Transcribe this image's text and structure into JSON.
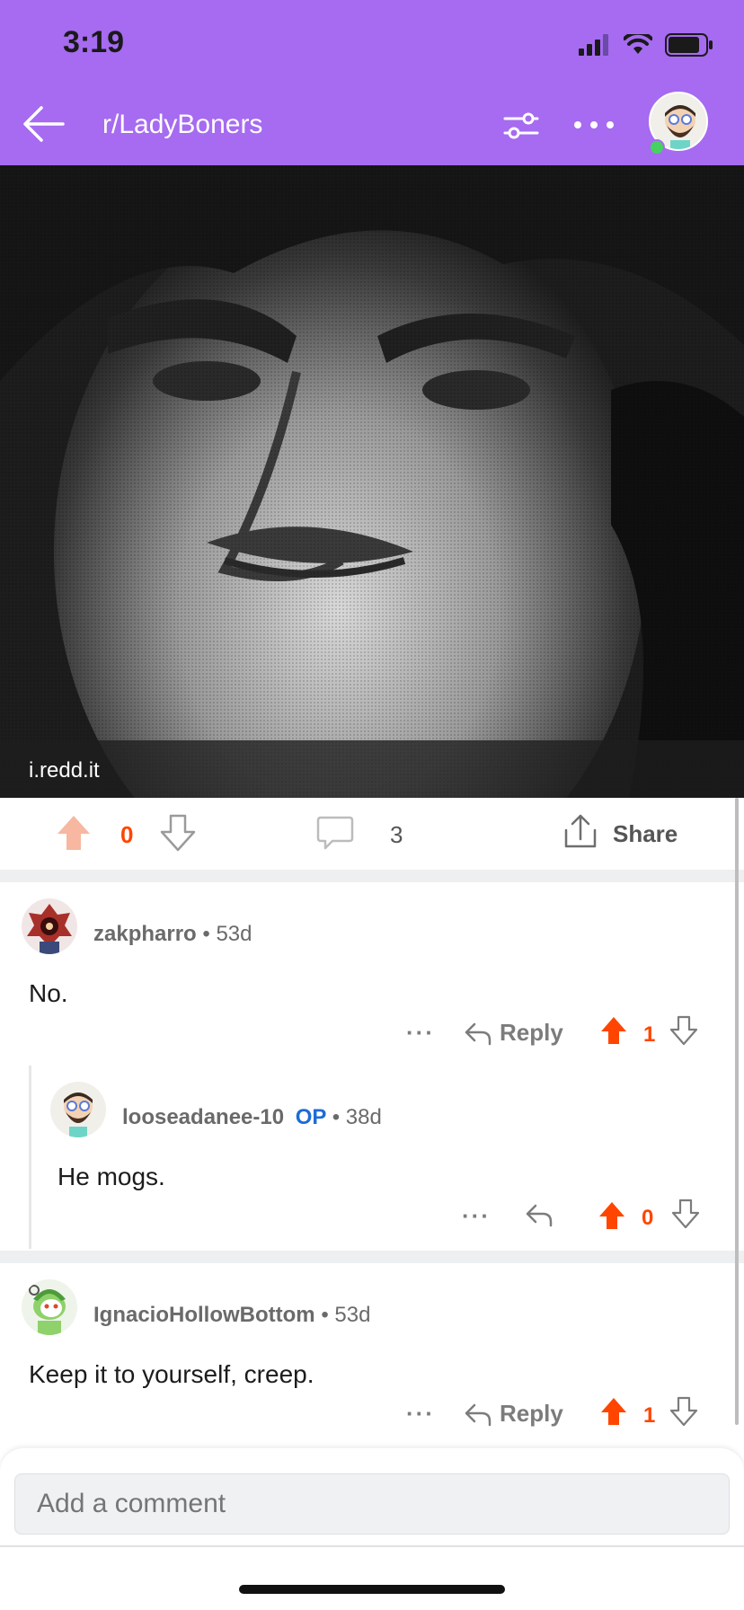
{
  "status_bar": {
    "time": "3:19"
  },
  "nav": {
    "title": "r/LadyBoners",
    "back_icon": "arrow-left-icon",
    "filter_icon": "sliders-icon",
    "more_icon": "ellipsis-icon"
  },
  "post": {
    "domain": "i.redd.it",
    "score": "0",
    "comment_count": "3",
    "share_label": "Share"
  },
  "comments": [
    {
      "author": "zakpharro",
      "op": "",
      "time": "53d",
      "body": "No.",
      "more": "···",
      "reply_label": "Reply",
      "score": "1"
    },
    {
      "author": "looseadanee-10",
      "op": "OP",
      "time": "38d",
      "body": "He mogs.",
      "more": "···",
      "reply_label": "",
      "score": "0"
    },
    {
      "author": "IgnacioHollowBottom",
      "op": "",
      "time": "53d",
      "body": "Keep it to yourself, creep.",
      "more": "···",
      "reply_label": "Reply",
      "score": "1"
    }
  ],
  "composer": {
    "placeholder": "Add a comment"
  },
  "colors": {
    "header": "#a66bf0",
    "upvote": "#ff4500",
    "op": "#1e6bd6"
  }
}
